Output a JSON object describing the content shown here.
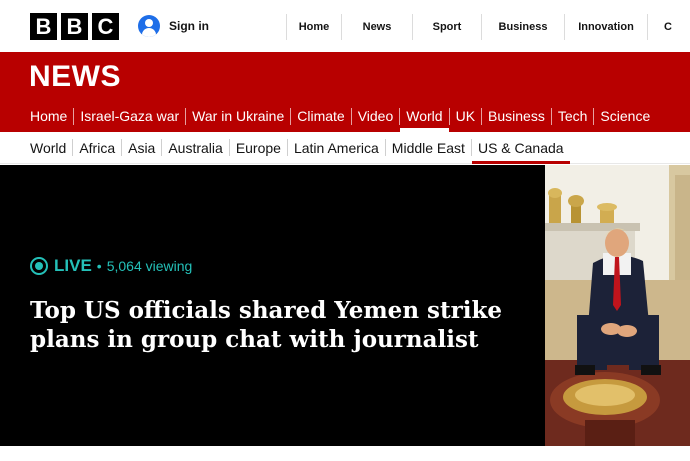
{
  "brand": {
    "logo_letters": [
      "B",
      "B",
      "C"
    ]
  },
  "account": {
    "signin_label": "Sign in"
  },
  "top_nav": [
    {
      "label": "Home"
    },
    {
      "label": "News"
    },
    {
      "label": "Sport"
    },
    {
      "label": "Business"
    },
    {
      "label": "Innovation"
    },
    {
      "label": "C"
    }
  ],
  "section": {
    "title": "NEWS"
  },
  "primary_nav": [
    {
      "label": "Home",
      "active": false
    },
    {
      "label": "Israel-Gaza war",
      "active": false
    },
    {
      "label": "War in Ukraine",
      "active": false
    },
    {
      "label": "Climate",
      "active": false
    },
    {
      "label": "Video",
      "active": false
    },
    {
      "label": "World",
      "active": true
    },
    {
      "label": "UK",
      "active": false
    },
    {
      "label": "Business",
      "active": false
    },
    {
      "label": "Tech",
      "active": false
    },
    {
      "label": "Science",
      "active": false
    }
  ],
  "secondary_nav": [
    {
      "label": "World",
      "active": false
    },
    {
      "label": "Africa",
      "active": false
    },
    {
      "label": "Asia",
      "active": false
    },
    {
      "label": "Australia",
      "active": false
    },
    {
      "label": "Europe",
      "active": false
    },
    {
      "label": "Latin America",
      "active": false
    },
    {
      "label": "Middle East",
      "active": false
    },
    {
      "label": "US & Canada",
      "active": true
    }
  ],
  "hero": {
    "live_label": "LIVE",
    "separator": "•",
    "viewing": "5,064 viewing",
    "headline": "Top US officials shared Yemen strike plans in group chat with journalist"
  },
  "colors": {
    "brand_red": "#b80000",
    "live_teal": "#24c0b8",
    "signin_blue": "#1e6ee8"
  },
  "icons": {
    "signin": "user-account-icon",
    "live": "live-indicator-icon"
  }
}
